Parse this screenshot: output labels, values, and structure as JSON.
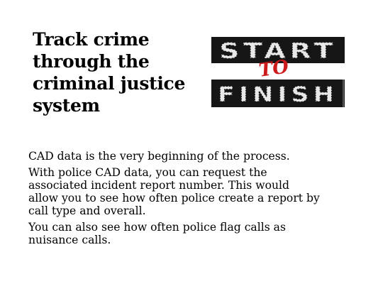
{
  "slide": {
    "title_lines": [
      "Track crime",
      "through the",
      "criminal justice",
      "system"
    ],
    "image": {
      "word_top": "START",
      "word_middle": "TO",
      "word_bottom": "FINISH",
      "colors": {
        "stripe": "#161616",
        "paint": "#e8e8e8",
        "accent": "#cc1b1b"
      }
    },
    "paragraphs": [
      {
        "lines": [
          "CAD data is the very beginning of the process."
        ]
      },
      {
        "lines": [
          "With police CAD data, you can request the",
          "associated incident report number. This would",
          "allow you to see how often police create a report by",
          "call type and overall."
        ]
      },
      {
        "lines": [
          "You can also see how often police flag calls as",
          "nuisance calls."
        ]
      }
    ]
  }
}
